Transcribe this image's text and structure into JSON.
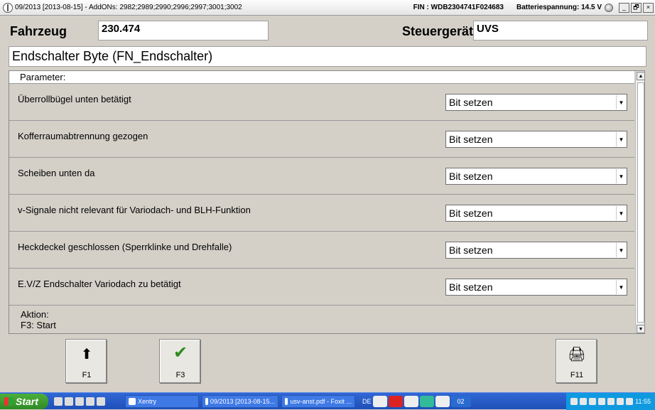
{
  "window": {
    "title": "09/2013 [2013-08-15] - AddONs: 2982;2989;2990;2996;2997;3001;3002",
    "fin": "FIN : WDB2304741F024683",
    "battery": "Batteriespannung: 14.5 V",
    "min_glyph": "_",
    "restore_glyph": "🗗",
    "close_glyph": "×"
  },
  "header": {
    "fahrzeug_label": "Fahrzeug",
    "fahrzeug_value": "230.474",
    "steuergeraet_label": "Steuergerät",
    "steuergeraet_value": "UVS"
  },
  "parameter_title": "Endschalter Byte (FN_Endschalter)",
  "panel": {
    "header": "Parameter:",
    "rows": [
      {
        "label": "Überrollbügel unten betätigt",
        "value": "Bit setzen"
      },
      {
        "label": "Kofferraumabtrennung gezogen",
        "value": "Bit setzen"
      },
      {
        "label": "Scheiben unten da",
        "value": "Bit setzen"
      },
      {
        "label": "v-Signale nicht relevant für Variodach- und BLH-Funktion",
        "value": "Bit setzen"
      },
      {
        "label": "Heckdeckel geschlossen (Sperrklinke und Drehfalle)",
        "value": "Bit setzen"
      },
      {
        "label": "E.V/Z Endschalter Variodach zu betätigt",
        "value": "Bit setzen"
      }
    ],
    "aktion_label": "Aktion:",
    "aktion_value": "F3: Start"
  },
  "fkeys": [
    {
      "label": "F1",
      "icon": "arrow-up-icon",
      "glyph": "⬆"
    },
    {
      "label": "F3",
      "icon": "checkmark-icon",
      "glyph": "✔"
    },
    {
      "label": "F11",
      "icon": "printer-icon",
      "glyph": "🖨"
    }
  ],
  "taskbar": {
    "start": "Start",
    "tasks": [
      "Xentry",
      "09/2013 [2013-08-15...",
      "usv-anst.pdf - Foxit ..."
    ],
    "lang": "DE",
    "badge": "02",
    "clock": "11:55"
  },
  "colors": {
    "taskbar": "#2457c8",
    "start": "#3a9b2e",
    "check": "#2e8b1e"
  }
}
